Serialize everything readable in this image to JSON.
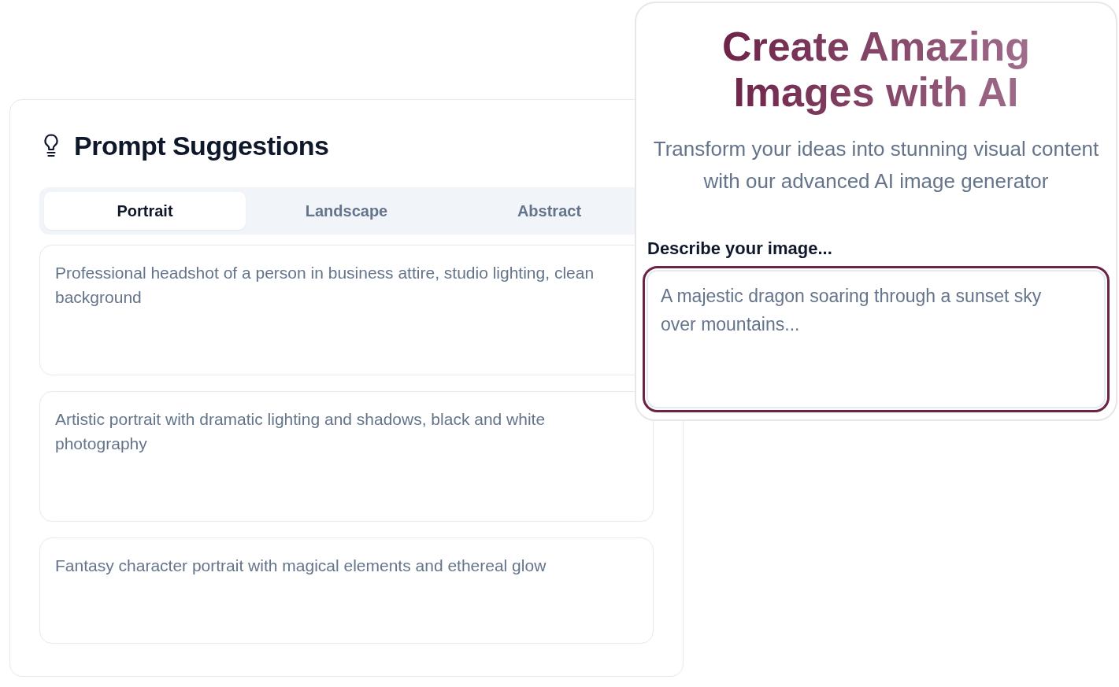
{
  "suggestions_panel": {
    "title": "Prompt Suggestions",
    "tabs": [
      {
        "label": "Portrait",
        "selected": true
      },
      {
        "label": "Landscape",
        "selected": false
      },
      {
        "label": "Abstract",
        "selected": false
      }
    ],
    "suggestions": [
      "Professional headshot of a person in business attire, studio lighting, clean background",
      "Artistic portrait with dramatic lighting and shadows, black and white photography",
      "Fantasy character portrait with magical elements and ethereal glow"
    ]
  },
  "generator_panel": {
    "title": "Create Amazing Images with AI",
    "subtitle": "Transform your ideas into stunning visual content with our advanced AI image generator",
    "prompt_label": "Describe your image...",
    "prompt_input": {
      "placeholder": "A majestic dragon soaring through a sunset sky over mountains...",
      "focused": true
    }
  }
}
